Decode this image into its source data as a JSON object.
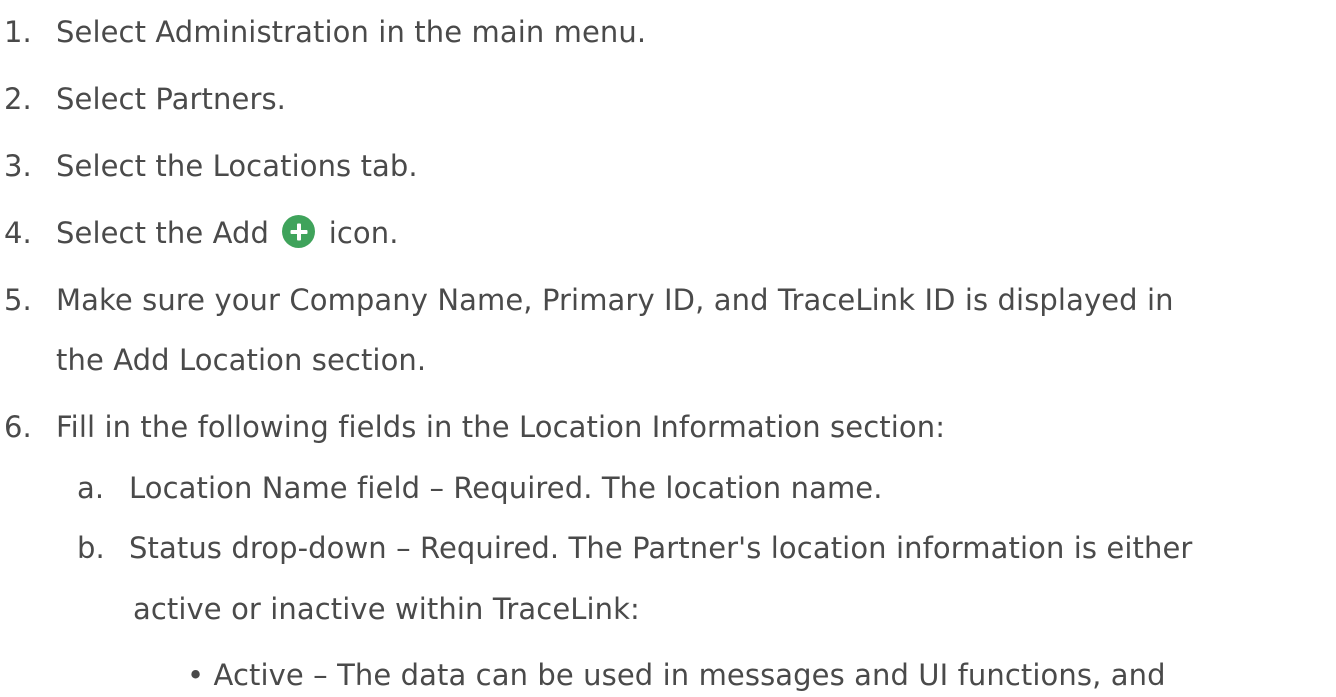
{
  "steps": {
    "s1": {
      "num": "1.",
      "text": "Select Administration in the main menu."
    },
    "s2": {
      "num": "2.",
      "text": "Select Partners."
    },
    "s3": {
      "num": "3.",
      "text": "Select the Locations tab."
    },
    "s4": {
      "num": "4.",
      "text_before": "Select the Add",
      "text_after": "icon.",
      "icon": "add-circle-icon",
      "icon_color": "#3fa35b"
    },
    "s5": {
      "num": "5.",
      "line1": "Make sure your Company Name, Primary ID, and TraceLink ID is displayed in",
      "line2": "the Add Location section."
    },
    "s6": {
      "num": "6.",
      "text": "Fill in the following fields in the Location Information section:"
    },
    "sa": {
      "num": "a.",
      "text": "Location Name field – Required. The location name."
    },
    "sb": {
      "num": "b.",
      "line1": "Status drop-down – Required. The Partner's location information is either",
      "line2": "active or inactive within TraceLink:"
    },
    "bullet": {
      "mark": "•",
      "text": "Active – The data can be used in messages and UI functions, and"
    }
  }
}
